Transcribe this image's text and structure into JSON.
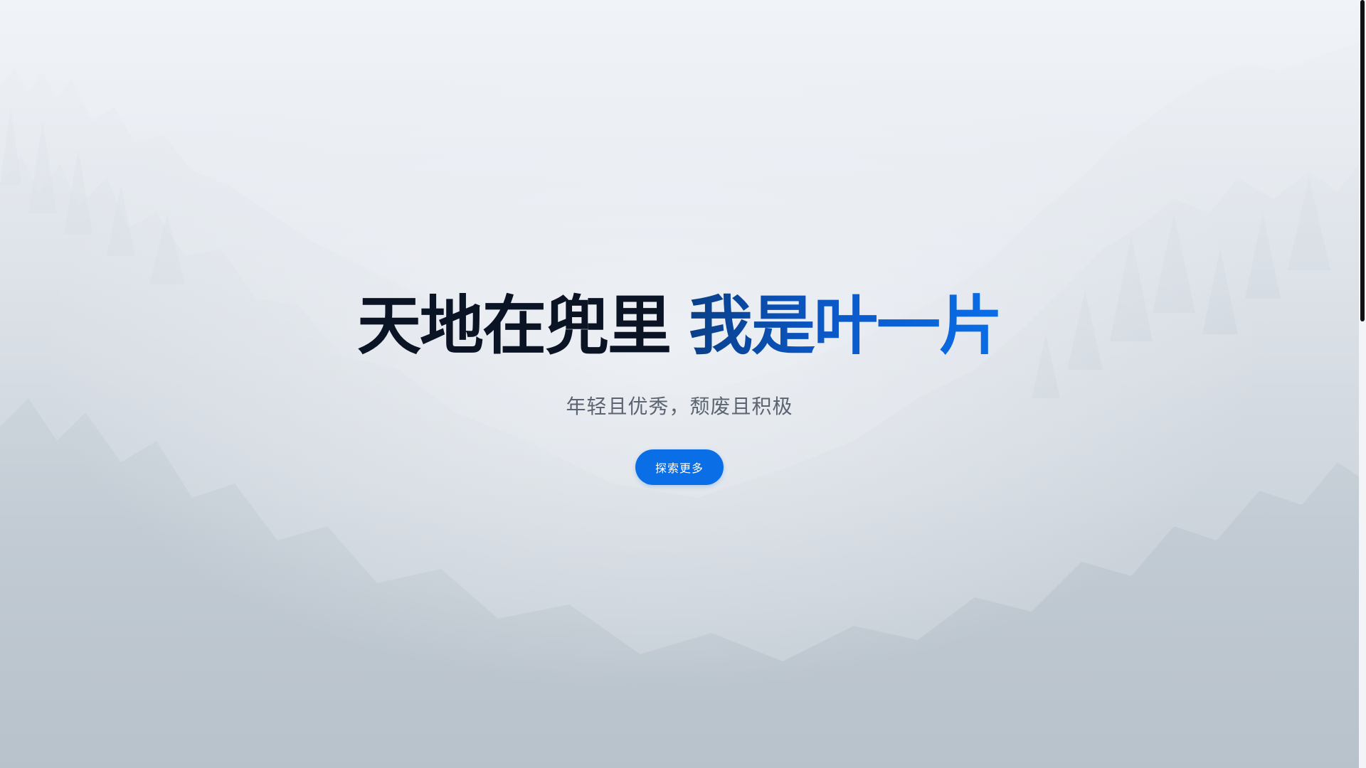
{
  "hero": {
    "headline_part1": "天地在兜里",
    "headline_part2": "我是叶一片",
    "subtitle": "年轻且优秀，颓废且积极",
    "cta_label": "探索更多"
  },
  "colors": {
    "accent": "#0a6fe6",
    "headline_dark": "#0b1424",
    "headline_gradient_start": "#0a3f86",
    "headline_gradient_end": "#0a6ee8",
    "subtitle": "#5b6470"
  },
  "background": {
    "description_icon": "misty-forest-image"
  },
  "scrollbar": {
    "position_fraction": 0.0
  }
}
